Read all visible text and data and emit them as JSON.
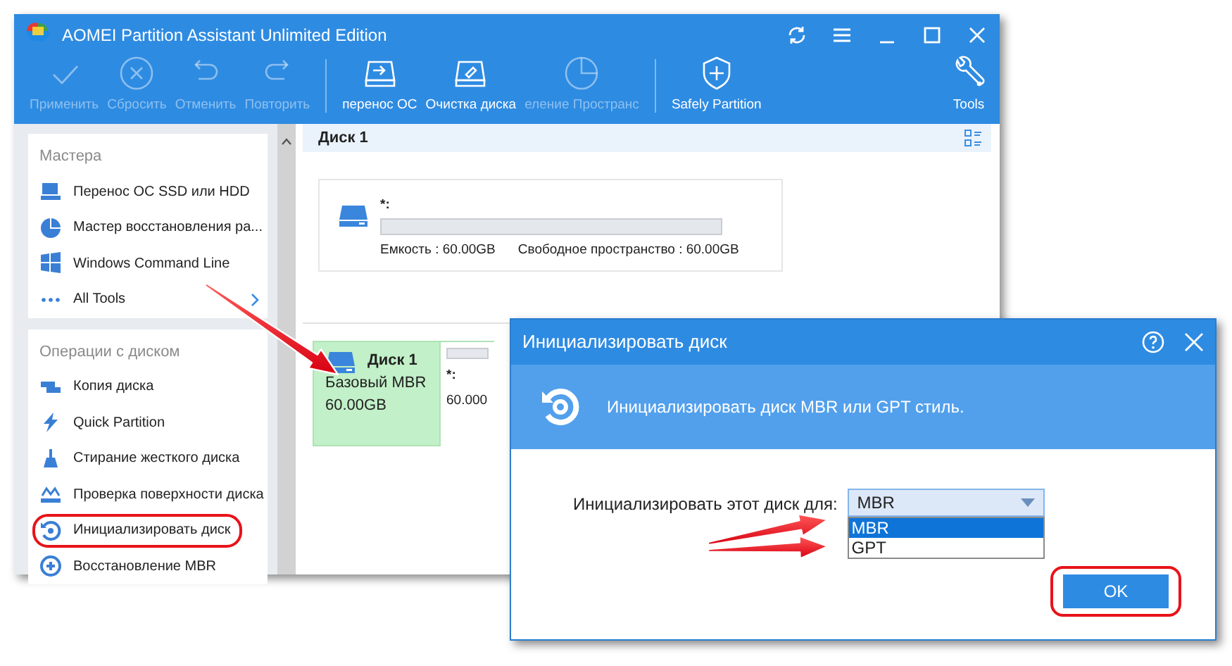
{
  "window": {
    "title": "AOMEI Partition Assistant Unlimited Edition"
  },
  "toolbar": [
    {
      "label": "Применить",
      "disabled": true
    },
    {
      "label": "Сбросить",
      "disabled": true
    },
    {
      "label": "Отменить",
      "disabled": true
    },
    {
      "label": "Повторить",
      "disabled": true
    },
    {
      "label": "перенос ОС",
      "disabled": false
    },
    {
      "label": "Очистка диска",
      "disabled": false
    },
    {
      "label": "еление Пространс",
      "disabled": true
    },
    {
      "label": "Safely Partition",
      "disabled": false
    },
    {
      "label": "Tools",
      "disabled": false
    }
  ],
  "sidebar": [
    {
      "title": "Мастера",
      "items": [
        {
          "label": "Перенос ОС SSD или HDD",
          "circled": false,
          "expandable": false
        },
        {
          "label": "Мастер восстановления ра...",
          "circled": false,
          "expandable": false
        },
        {
          "label": "Windows Command Line",
          "circled": false,
          "expandable": false
        },
        {
          "label": "All Tools",
          "circled": false,
          "expandable": true
        }
      ]
    },
    {
      "title": "Операции с диском",
      "items": [
        {
          "label": "Копия диска",
          "circled": false,
          "expandable": false
        },
        {
          "label": "Quick Partition",
          "circled": false,
          "expandable": false
        },
        {
          "label": "Стирание жесткого диска",
          "circled": false,
          "expandable": false
        },
        {
          "label": "Проверка поверхности диска",
          "circled": false,
          "expandable": false
        },
        {
          "label": "Инициализировать диск",
          "circled": true,
          "expandable": false
        },
        {
          "label": "Восстановление MBR",
          "circled": false,
          "expandable": false
        }
      ]
    }
  ],
  "disk_header": {
    "title": "Диск 1"
  },
  "partition_card": {
    "name": "*:",
    "capacity": "Емкость : 60.00GB",
    "free": "Свободное пространство : 60.00GB"
  },
  "disk_row": {
    "name": "Диск 1",
    "type": "Базовый MBR",
    "size": "60.00GB",
    "selected": true,
    "partition": {
      "name": "*:",
      "size": "60.000"
    }
  },
  "dialog": {
    "title": "Инициализировать диск",
    "banner": "Инициализировать диск MBR или GPT стиль.",
    "label": "Инициализировать этот диск для:",
    "value": "MBR",
    "options": [
      {
        "label": "MBR",
        "selected": true
      },
      {
        "label": "GPT",
        "selected": false
      }
    ],
    "button": {
      "label": "OK",
      "circled": true
    }
  }
}
